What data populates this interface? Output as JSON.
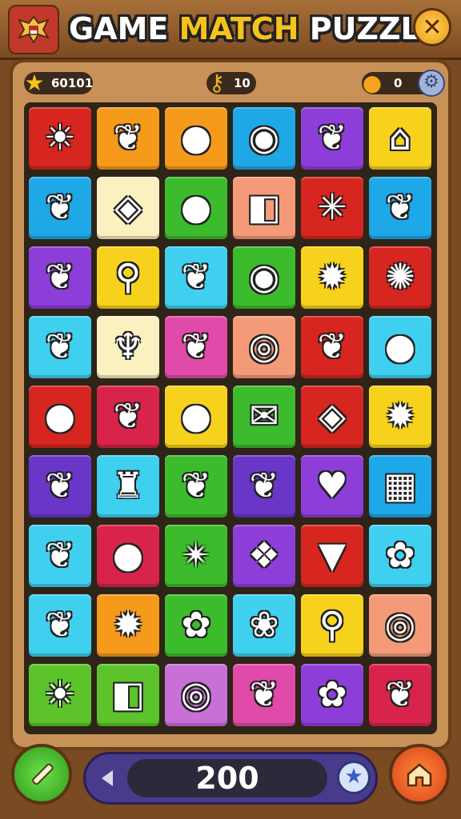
{
  "header": {
    "title_part1": "GAME ",
    "title_part2": "MATCH",
    "title_part3": " PUZZLA",
    "close_label": "✕"
  },
  "stats": {
    "stars": "60101",
    "keys": "10",
    "coins": "0"
  },
  "score": {
    "value": "200"
  },
  "colors": {
    "red": "#d7261f",
    "orange": "#f59a1b",
    "yellow": "#f7d21c",
    "blue": "#1ea8e8",
    "cyan": "#3fd0f0",
    "purple": "#8e3ed8",
    "green": "#3cbc2c",
    "pink": "#e04aa8",
    "salmon": "#f49a78",
    "cream": "#fbf0c0",
    "crimson": "#d8244a",
    "violet": "#6a36c8",
    "magenta": "#c870d8",
    "lime": "#5cc42a"
  },
  "board": {
    "rows": [
      [
        {
          "c": "red",
          "icon": "sun-icon",
          "g": "☀"
        },
        {
          "c": "orange",
          "icon": "leaf-icon",
          "g": "❦"
        },
        {
          "c": "orange",
          "icon": "lollipop-icon",
          "g": "●"
        },
        {
          "c": "blue",
          "icon": "lantern-icon",
          "g": "◉"
        },
        {
          "c": "purple",
          "icon": "leaf-icon",
          "g": "❦"
        },
        {
          "c": "yellow",
          "icon": "house-icon",
          "g": "⌂"
        }
      ],
      [
        {
          "c": "blue",
          "icon": "leaf-icon",
          "g": "❦"
        },
        {
          "c": "cream",
          "icon": "box-icon",
          "g": "◈"
        },
        {
          "c": "green",
          "icon": "orb-icon",
          "g": "●"
        },
        {
          "c": "salmon",
          "icon": "box-icon",
          "g": "◧"
        },
        {
          "c": "red",
          "icon": "palm-icon",
          "g": "✳"
        },
        {
          "c": "blue",
          "icon": "leaf-icon",
          "g": "❦"
        }
      ],
      [
        {
          "c": "purple",
          "icon": "leaf-icon",
          "g": "❦"
        },
        {
          "c": "yellow",
          "icon": "key-icon",
          "g": "⚲"
        },
        {
          "c": "cyan",
          "icon": "leaf-icon",
          "g": "❦"
        },
        {
          "c": "green",
          "icon": "lantern-icon",
          "g": "◉"
        },
        {
          "c": "yellow",
          "icon": "gear-icon",
          "g": "✹"
        },
        {
          "c": "red",
          "icon": "bug-icon",
          "g": "✺"
        }
      ],
      [
        {
          "c": "cyan",
          "icon": "leaf-icon",
          "g": "❦"
        },
        {
          "c": "cream",
          "icon": "garuda-icon",
          "g": "♆"
        },
        {
          "c": "pink",
          "icon": "leaf-icon",
          "g": "❦"
        },
        {
          "c": "salmon",
          "icon": "spiral-icon",
          "g": "◎"
        },
        {
          "c": "red",
          "icon": "leaf-icon",
          "g": "❦"
        },
        {
          "c": "cyan",
          "icon": "spoon-icon",
          "g": "●"
        }
      ],
      [
        {
          "c": "red",
          "icon": "bubble-icon",
          "g": "●"
        },
        {
          "c": "crimson",
          "icon": "leaf-icon",
          "g": "❦"
        },
        {
          "c": "yellow",
          "icon": "orb-icon",
          "g": "●"
        },
        {
          "c": "green",
          "icon": "envelope-icon",
          "g": "✉"
        },
        {
          "c": "red",
          "icon": "box-icon",
          "g": "◈"
        },
        {
          "c": "yellow",
          "icon": "sun-icon",
          "g": "✹"
        }
      ],
      [
        {
          "c": "violet",
          "icon": "leaf-icon",
          "g": "❦"
        },
        {
          "c": "cyan",
          "icon": "totem-icon",
          "g": "♜"
        },
        {
          "c": "green",
          "icon": "leaf-icon",
          "g": "❦"
        },
        {
          "c": "violet",
          "icon": "leaf-icon",
          "g": "❦"
        },
        {
          "c": "purple",
          "icon": "heart-icon",
          "g": "♥"
        },
        {
          "c": "blue",
          "icon": "shop-icon",
          "g": "▦"
        }
      ],
      [
        {
          "c": "cyan",
          "icon": "leaf-icon",
          "g": "❦"
        },
        {
          "c": "crimson",
          "icon": "lollipop-icon",
          "g": "●"
        },
        {
          "c": "green",
          "icon": "banana-icon",
          "g": "✴"
        },
        {
          "c": "purple",
          "icon": "bone-icon",
          "g": "❖"
        },
        {
          "c": "red",
          "icon": "cone-icon",
          "g": "▼"
        },
        {
          "c": "cyan",
          "icon": "flower-icon",
          "g": "✿"
        }
      ],
      [
        {
          "c": "cyan",
          "icon": "leaf-icon",
          "g": "❦"
        },
        {
          "c": "orange",
          "icon": "sun-icon",
          "g": "✹"
        },
        {
          "c": "green",
          "icon": "flower-icon",
          "g": "✿"
        },
        {
          "c": "cyan",
          "icon": "flower-icon",
          "g": "❀"
        },
        {
          "c": "yellow",
          "icon": "bulb-icon",
          "g": "⚲"
        },
        {
          "c": "salmon",
          "icon": "ring-icon",
          "g": "◎"
        }
      ],
      [
        {
          "c": "lime",
          "icon": "sun-icon",
          "g": "☀"
        },
        {
          "c": "lime",
          "icon": "box-icon",
          "g": "◧"
        },
        {
          "c": "magenta",
          "icon": "spiral-icon",
          "g": "◎"
        },
        {
          "c": "pink",
          "icon": "leaf-icon",
          "g": "❦"
        },
        {
          "c": "purple",
          "icon": "flower-icon",
          "g": "✿"
        },
        {
          "c": "crimson",
          "icon": "leaf-icon",
          "g": "❦"
        }
      ]
    ]
  }
}
